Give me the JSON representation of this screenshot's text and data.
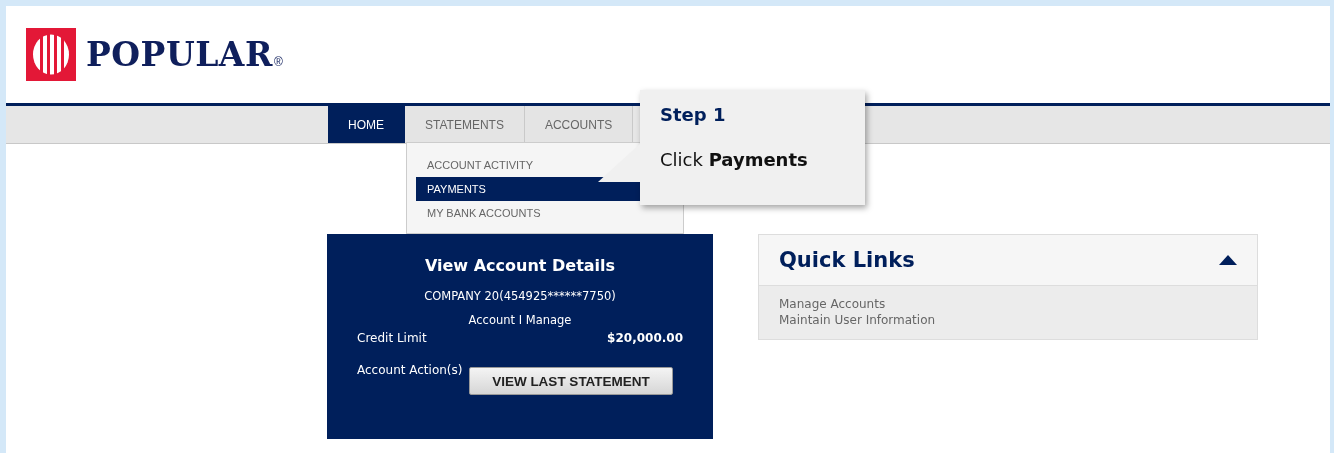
{
  "brand": {
    "name": "POPULAR",
    "mark": "®"
  },
  "tabs": [
    {
      "label": "HOME",
      "selected": true
    },
    {
      "label": "STATEMENTS",
      "selected": false
    },
    {
      "label": "ACCOUNTS",
      "selected": false
    }
  ],
  "dropdown": {
    "items": [
      {
        "label": "ACCOUNT ACTIVITY",
        "selected": false
      },
      {
        "label": "PAYMENTS",
        "selected": true
      },
      {
        "label": "MY BANK ACCOUNTS",
        "selected": false
      }
    ]
  },
  "callout": {
    "title": "Step 1",
    "text": "Click **Payments**"
  },
  "account_card": {
    "title": "View Account Details",
    "account": "COMPANY 20(454925******7750)",
    "subtitle": "Account I Manage",
    "limit_label": "Credit Limit",
    "limit_value": "$20,000.00",
    "actions_label": "Account Action(s)",
    "button": "VIEW LAST STATEMENT"
  },
  "quick_links": {
    "title": "Quick Links",
    "expanded": true,
    "links": [
      "Manage Accounts",
      "Maintain User Information"
    ]
  }
}
